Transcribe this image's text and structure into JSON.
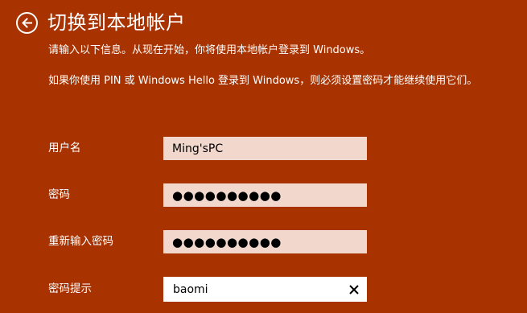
{
  "header": {
    "title": "切换到本地帐户",
    "back_icon": "back-arrow-icon"
  },
  "description": {
    "line1": "请输入以下信息。从现在开始，你将使用本地帐户登录到 Windows。",
    "line2": "如果你使用 PIN 或 Windows Hello 登录到 Windows，则必须设置密码才能继续使用它们。"
  },
  "form": {
    "username": {
      "label": "用户名",
      "value": "Ming'sPC"
    },
    "password": {
      "label": "密码",
      "value": "●●●●●●●●●●"
    },
    "confirm_password": {
      "label": "重新输入密码",
      "value": "●●●●●●●●●●"
    },
    "password_hint": {
      "label": "密码提示",
      "value": "baomi",
      "clear_icon": "close-icon"
    }
  },
  "colors": {
    "background": "#a93300",
    "field_background": "#f1d7cc",
    "active_field_background": "#ffffff",
    "text": "#ffffff"
  }
}
